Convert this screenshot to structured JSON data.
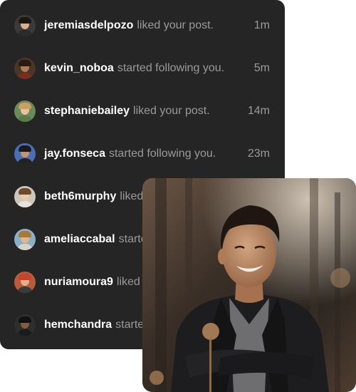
{
  "notifications": [
    {
      "username": "jeremiasdelpozo",
      "action": "liked your post.",
      "time": "1m",
      "avatar_icon": "avatar-man-dark-hair",
      "bg": "#3a3a3a",
      "face": "#d9b08c",
      "hair": "#1d1510",
      "shirt": "#2b2b2b"
    },
    {
      "username": "kevin_noboa",
      "action": "started following you.",
      "time": "5m",
      "avatar_icon": "avatar-man-beard",
      "bg": "#4a3526",
      "face": "#b07a55",
      "hair": "#2a1a12",
      "shirt": "#7a2e20"
    },
    {
      "username": "stephaniebailey",
      "action": "liked your post.",
      "time": "14m",
      "avatar_icon": "avatar-woman-blonde",
      "bg": "#6a8a5a",
      "face": "#e8c2a0",
      "hair": "#c9a063",
      "shirt": "#5a7a4a"
    },
    {
      "username": "jay.fonseca",
      "action": "started following you.",
      "time": "23m",
      "avatar_icon": "avatar-man-blue-bg",
      "bg": "#4a6fb5",
      "face": "#c89270",
      "hair": "#1a1a1a",
      "shirt": "#222222"
    },
    {
      "username": "beth6murphy",
      "action": "liked your post.",
      "time": "",
      "avatar_icon": "avatar-woman-light",
      "bg": "#cfc6bb",
      "face": "#ecc9a8",
      "hair": "#6b4a2e",
      "shirt": "#e7e2db"
    },
    {
      "username": "ameliaccabal",
      "action": "started following you.",
      "time": "",
      "avatar_icon": "avatar-woman-curly",
      "bg": "#8ab0c8",
      "face": "#e2b48f",
      "hair": "#a5793d",
      "shirt": "#d9d2c6"
    },
    {
      "username": "nuriamoura9",
      "action": "liked your post.",
      "time": "",
      "avatar_icon": "avatar-woman-hat",
      "bg": "#b85a3c",
      "face": "#e0b08a",
      "hair": "#c4452c",
      "shirt": "#3a3a3a"
    },
    {
      "username": "hemchandra",
      "action": "started following you.",
      "time": "",
      "avatar_icon": "avatar-man-dark",
      "bg": "#2e2e2e",
      "face": "#8a5a3c",
      "hair": "#111111",
      "shirt": "#1b1b1b"
    }
  ],
  "photo": {
    "icon": "smiling-man-photo"
  }
}
